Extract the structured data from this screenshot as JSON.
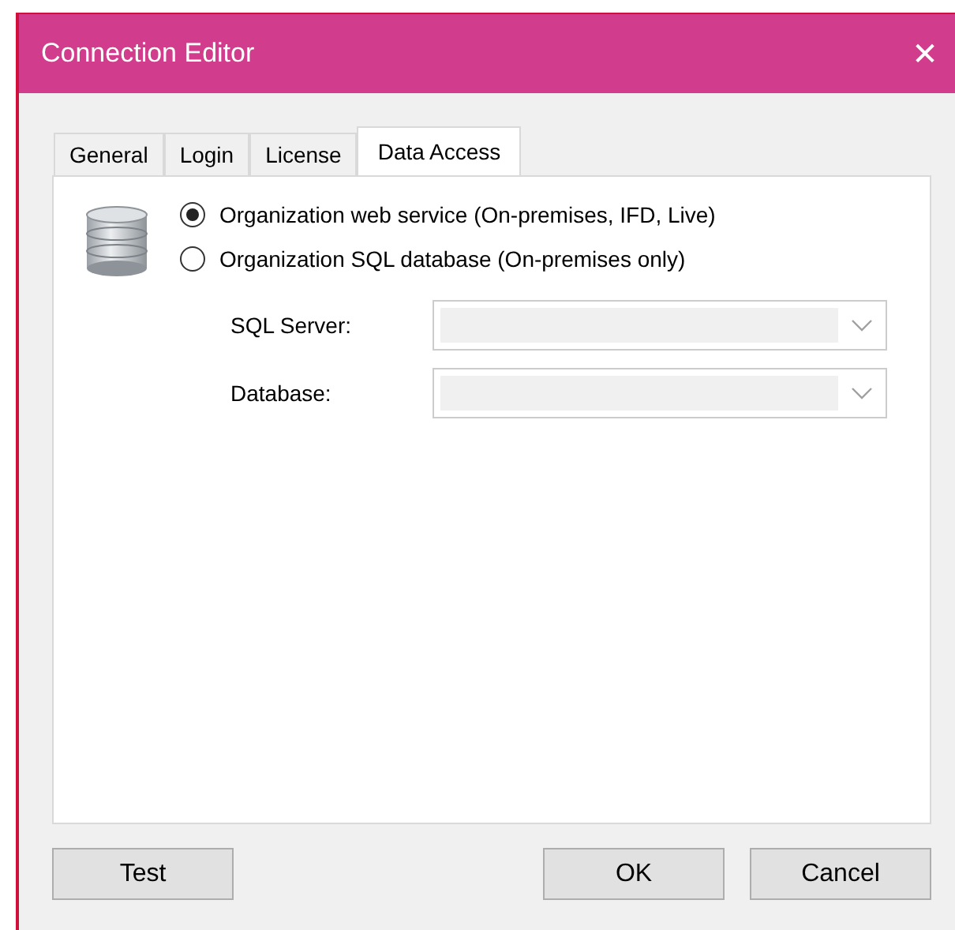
{
  "window": {
    "title": "Connection Editor",
    "close": "✕"
  },
  "tabs": [
    {
      "label": "General",
      "selected": false
    },
    {
      "label": "Login",
      "selected": false
    },
    {
      "label": "License",
      "selected": false
    },
    {
      "label": "Data Access",
      "selected": true
    }
  ],
  "options": [
    {
      "label": "Organization web service (On-premises, IFD, Live)",
      "selected": true
    },
    {
      "label": "Organization SQL database (On-premises only)",
      "selected": false
    }
  ],
  "fields": [
    {
      "label": "SQL Server:",
      "disabled": true
    },
    {
      "label": "Database:",
      "disabled": true
    }
  ],
  "buttons": {
    "left": [
      "Test"
    ],
    "right": [
      "OK",
      "Cancel"
    ]
  }
}
